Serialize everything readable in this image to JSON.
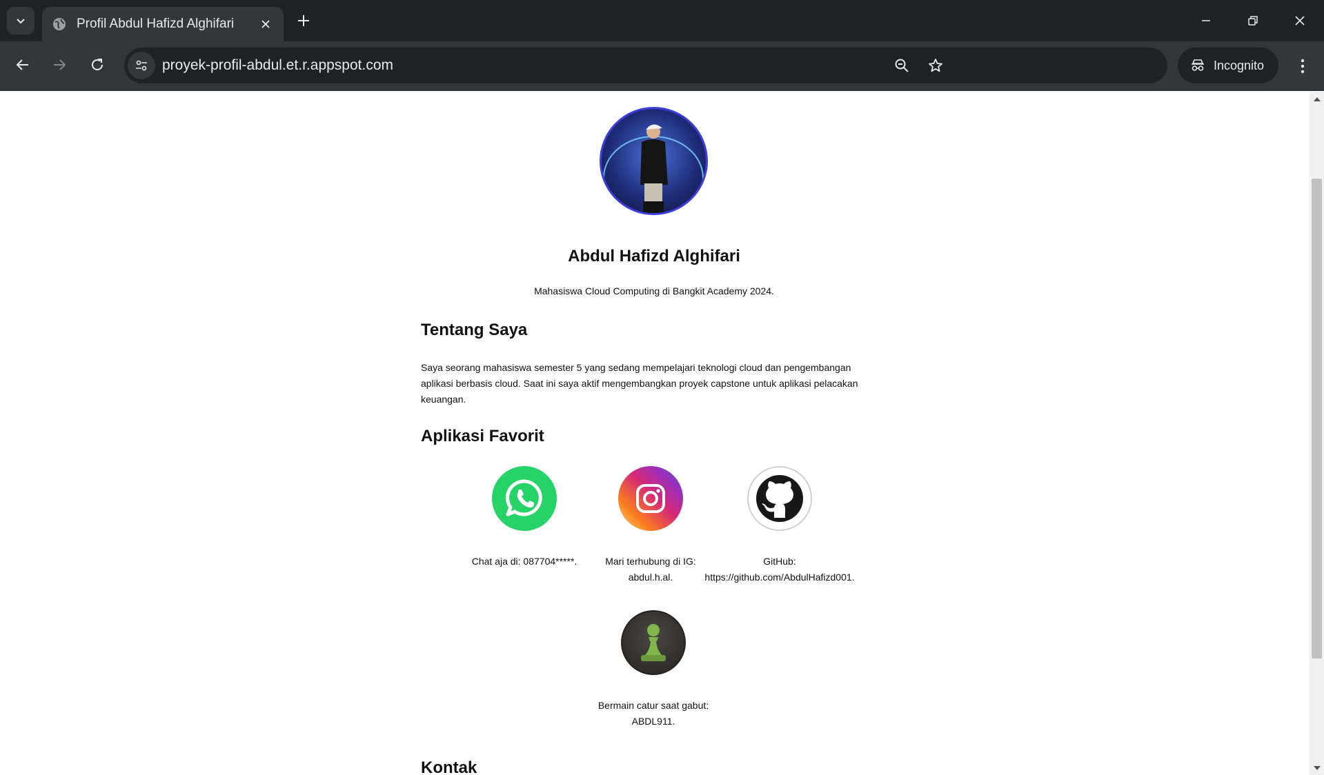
{
  "browser": {
    "tab_title": "Profil Abdul Hafizd Alghifari",
    "url": "proyek-profil-abdul.et.r.appspot.com",
    "incognito_label": "Incognito"
  },
  "page": {
    "name": "Abdul Hafizd Alghifari",
    "description": "Mahasiswa Cloud Computing di Bangkit Academy 2024.",
    "about": {
      "title": "Tentang Saya",
      "text": "Saya seorang mahasiswa semester 5 yang sedang mempelajari teknologi cloud dan pengembangan aplikasi berbasis cloud. Saat ini saya aktif mengembangkan proyek capstone untuk aplikasi pelacakan keuangan."
    },
    "favorites": {
      "title": "Aplikasi Favorit",
      "items": [
        {
          "icon": "whatsapp-icon",
          "line1": "Chat aja di: 087704*****.",
          "line2": ""
        },
        {
          "icon": "instagram-icon",
          "line1": "Mari terhubung di IG:",
          "line2": "abdul.h.al."
        },
        {
          "icon": "github-icon",
          "line1": "GitHub:",
          "line2": "https://github.com/AbdulHafizd001."
        },
        {
          "icon": "chess-icon",
          "line1": "Bermain catur saat gabut:",
          "line2": "ABDL911."
        }
      ]
    },
    "contact": {
      "title": "Kontak"
    }
  },
  "colors": {
    "chrome_dark": "#202124",
    "chrome_mid": "#35363a",
    "whatsapp": "#25d366",
    "github": "#181717",
    "chess_bg": "#302e2b",
    "chess_pawn": "#81b64c"
  }
}
